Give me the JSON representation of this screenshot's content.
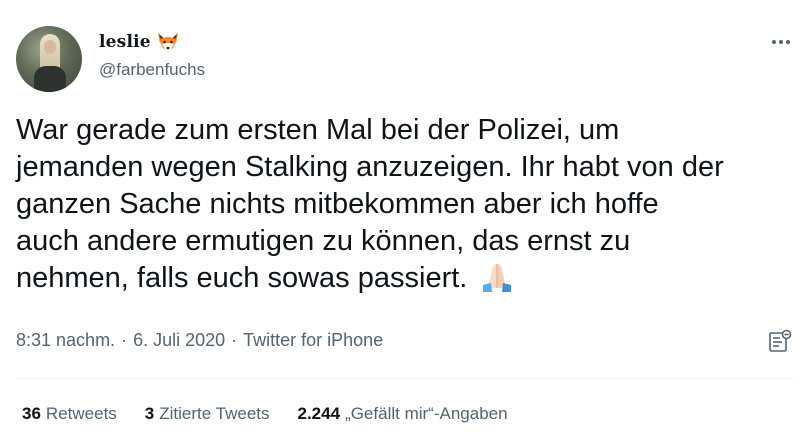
{
  "author": {
    "display_name": "leslie",
    "name_emoji": "fox-face-icon",
    "handle": "@farbenfuchs"
  },
  "tweet": {
    "text": "War gerade zum ersten Mal bei der Polizei, um\njemanden wegen Stalking anzuzeigen. Ihr habt von der\nganzen Sache nichts mitbekommen aber ich hoffe\nauch andere ermutigen zu können, das ernst zu\nnehmen, falls euch sowas passiert.",
    "emoji": "folded-hands-icon"
  },
  "meta": {
    "time": "8:31 nachm.",
    "separator": "·",
    "date": "6. Juli 2020",
    "source": "Twitter for iPhone"
  },
  "stats": {
    "retweets_count": "36",
    "retweets_label": "Retweets",
    "quotes_count": "3",
    "quotes_label": "Zitierte Tweets",
    "likes_count": "2.244",
    "likes_label": "„Gefällt mir“-Angaben"
  },
  "colors": {
    "text_primary": "#0f1419",
    "text_secondary": "#536471",
    "divider": "#eff3f4"
  }
}
